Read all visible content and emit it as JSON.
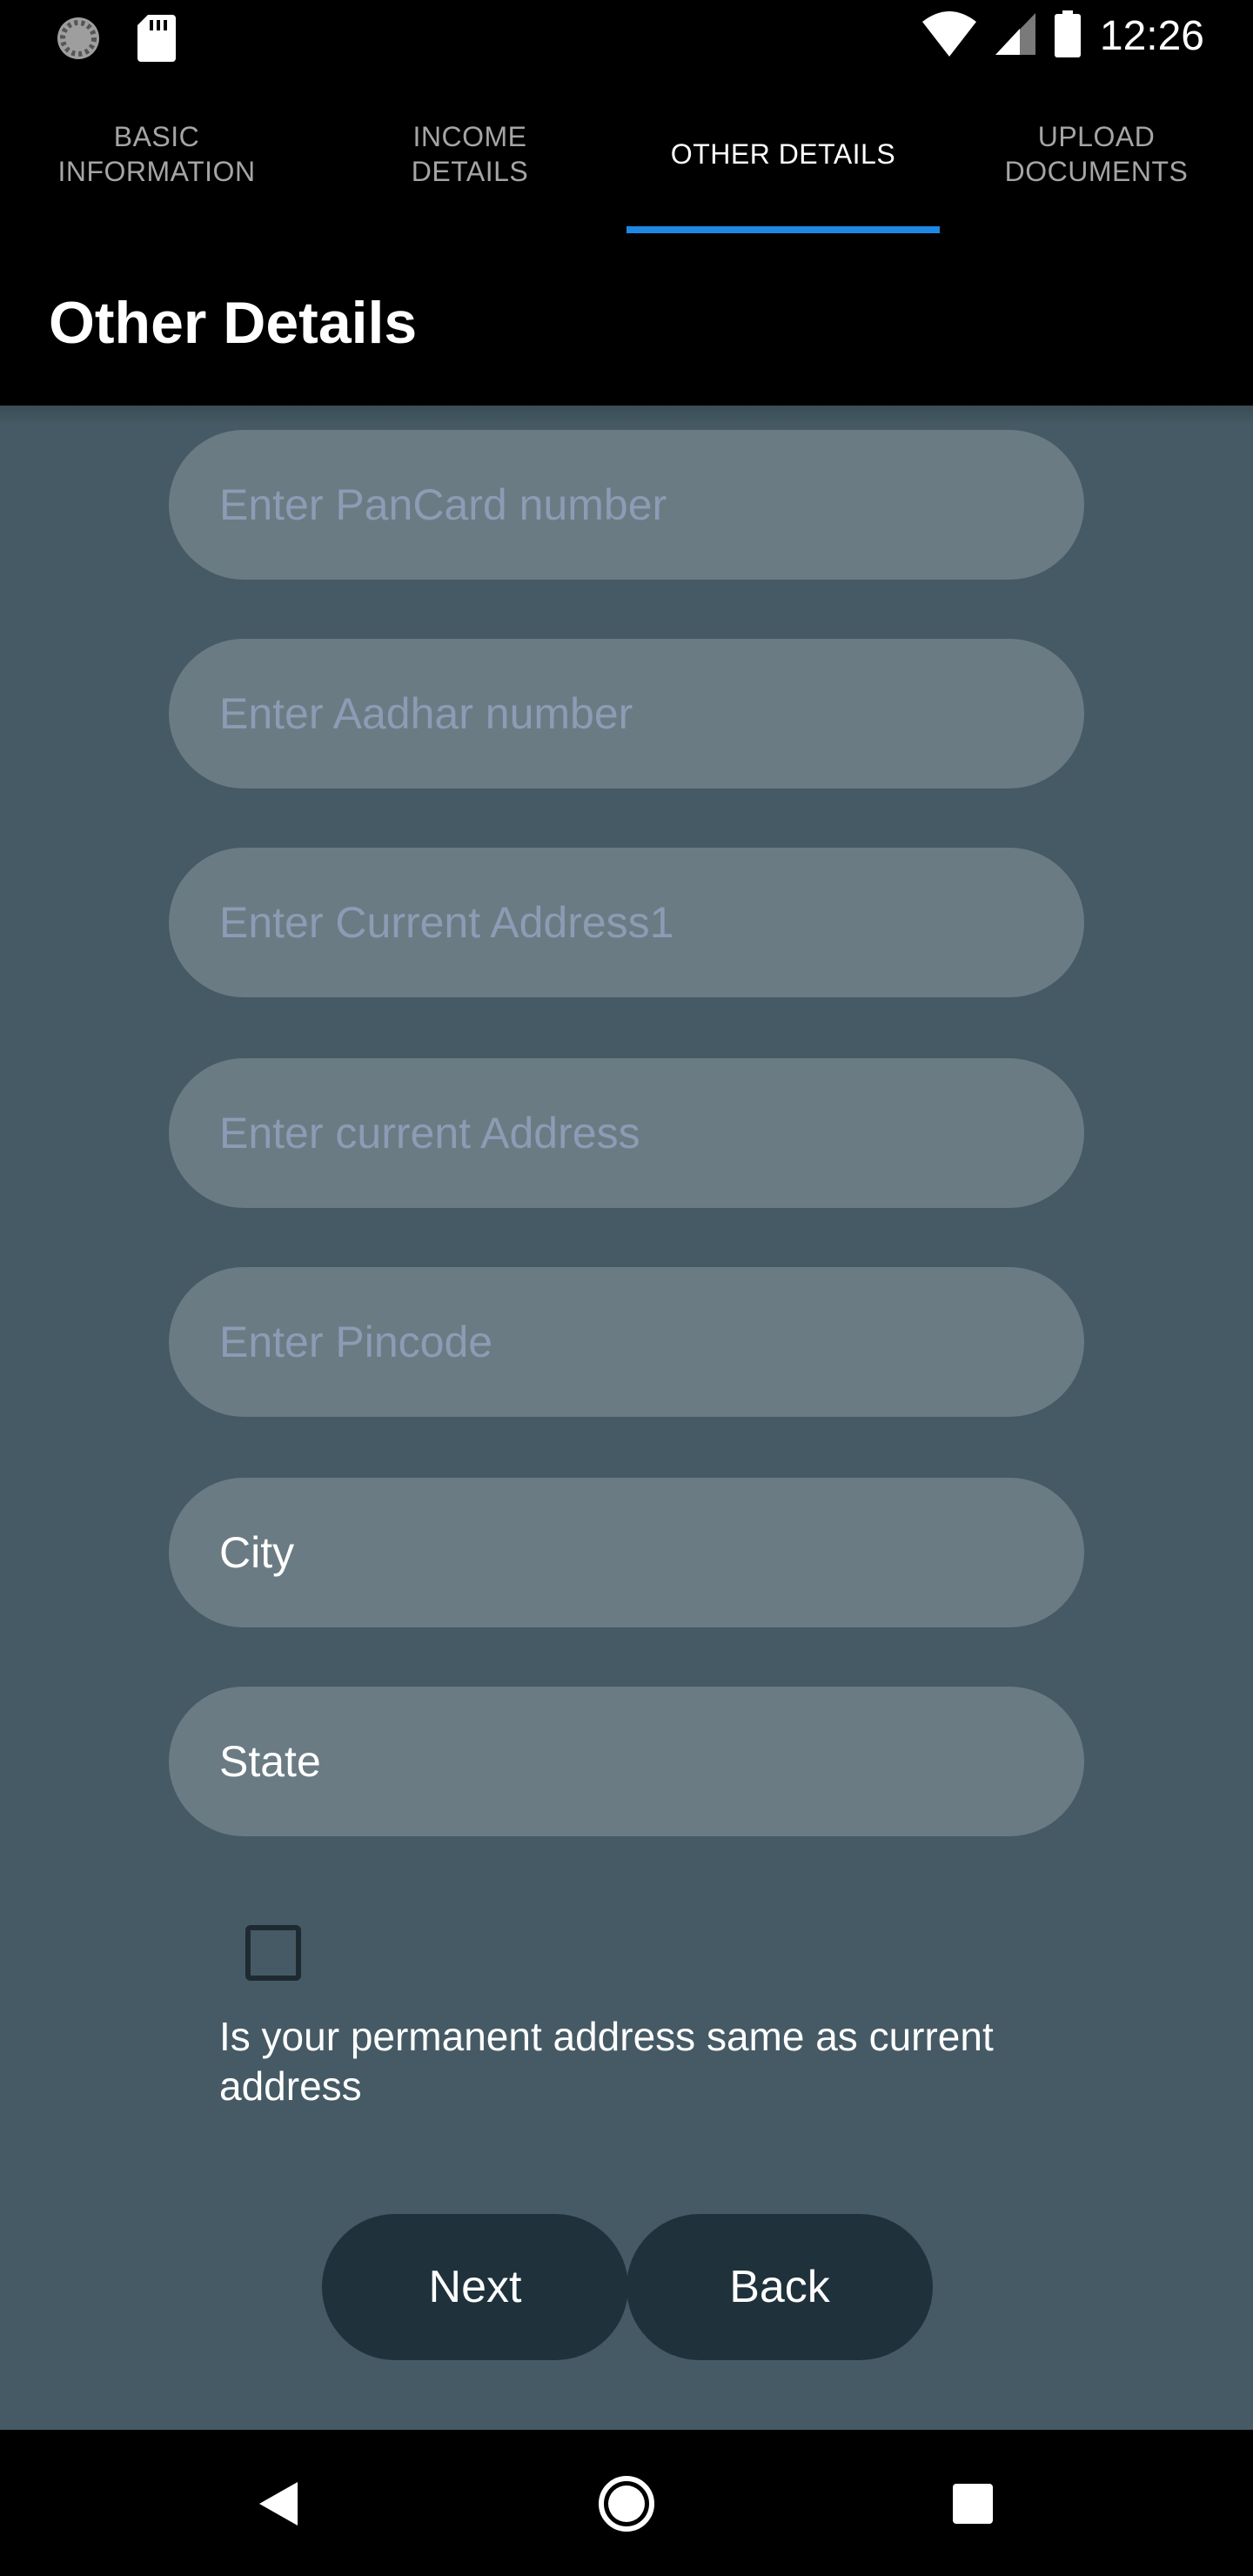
{
  "status_bar": {
    "time": "12:26",
    "left_icons": [
      "loading-circle-icon",
      "sd-card-icon"
    ],
    "right_icons": [
      "wifi-icon",
      "cell-signal-icon",
      "battery-icon"
    ]
  },
  "tabs": [
    {
      "label": "BASIC\nINFORMATION",
      "active": false
    },
    {
      "label": "INCOME\nDETAILS",
      "active": false
    },
    {
      "label": "OTHER DETAILS",
      "active": true
    },
    {
      "label": "UPLOAD\nDOCUMENTS",
      "active": false
    }
  ],
  "page_title": "Other Details",
  "form": {
    "pancard_placeholder": "Enter PanCard number",
    "aadhar_placeholder": "Enter Aadhar number",
    "address1_placeholder": "Enter Current Address1",
    "address2_placeholder": "Enter current Address",
    "pincode_placeholder": "Enter Pincode",
    "city_value": "City",
    "state_value": "State",
    "checkbox_checked": false,
    "checkbox_label": "Is your permanent address same as current address"
  },
  "buttons": {
    "next_label": "Next",
    "back_label": "Back"
  },
  "nav_bar": {
    "icons": [
      "back-triangle-icon",
      "home-circle-icon",
      "recents-square-icon"
    ]
  },
  "colors": {
    "accent": "#1e88e5",
    "form_background": "#455a64",
    "field_background": "#6b7b83",
    "button_background": "#1f323c"
  }
}
